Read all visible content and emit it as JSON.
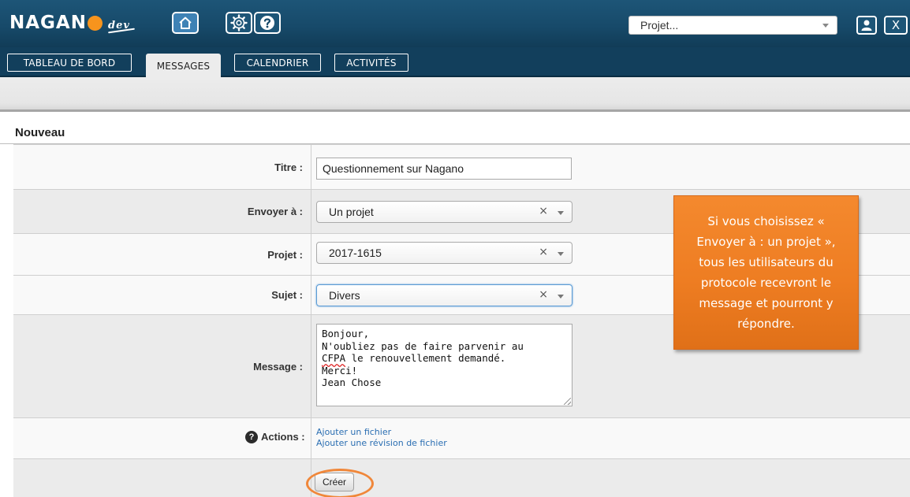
{
  "header": {
    "logo_text": "NAGANO",
    "logo_suffix": "dev",
    "project_select": {
      "value": "Projet..."
    },
    "close_label": "X"
  },
  "tabs": [
    {
      "label": "TABLEAU DE BORD",
      "active": false
    },
    {
      "label": "MESSAGES",
      "active": true
    },
    {
      "label": "CALENDRIER",
      "active": false
    },
    {
      "label": "ACTIVITÉS",
      "active": false
    }
  ],
  "form": {
    "title": "Nouveau",
    "titre": {
      "label": "Titre :",
      "value": "Questionnement sur Nagano"
    },
    "envoyer": {
      "label": "Envoyer à :",
      "value": "Un projet"
    },
    "projet": {
      "label": "Projet :",
      "value": "2017-1615"
    },
    "sujet": {
      "label": "Sujet :",
      "value": "Divers"
    },
    "message": {
      "label": "Message :",
      "line1": "Bonjour,",
      "line2": "N'oubliez pas de faire parvenir au",
      "line3_underlined": "CFPA",
      "line3_rest": " le renouvellement demandé.",
      "line4": "Merci!",
      "line5": "Jean Chose"
    },
    "actions": {
      "label": "Actions :",
      "help_icon": "?",
      "links": [
        "Ajouter un fichier",
        "Ajouter une révision de fichier"
      ]
    },
    "create_label": "Créer",
    "clear_glyph": "×"
  },
  "callout": {
    "text": "Si vous choisissez « Envoyer à : un projet », tous les utilisateurs du protocole recevront le message et pourront y répondre."
  },
  "colors": {
    "header_blue": "#174a6a",
    "logo_orange": "#f7941d",
    "callout_orange": "#ee7d22",
    "link_blue": "#2a6eb2",
    "highlight_ring": "#f0873a"
  }
}
